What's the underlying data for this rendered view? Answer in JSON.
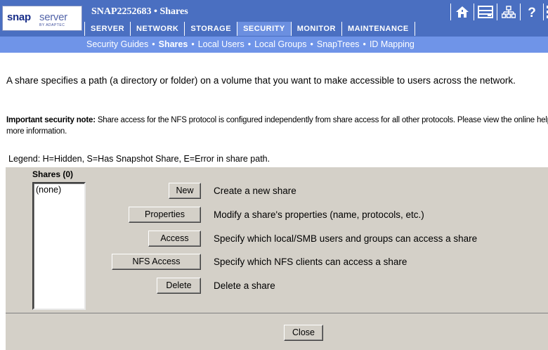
{
  "logo": {
    "brand_bold": "snap",
    "brand_light": "server",
    "sub": "BY ADAPTEC"
  },
  "header": {
    "title": "SNAP2252683 • Shares"
  },
  "tabs": [
    {
      "label": "SERVER"
    },
    {
      "label": "NETWORK"
    },
    {
      "label": "STORAGE"
    },
    {
      "label": "SECURITY",
      "active": true
    },
    {
      "label": "MONITOR"
    },
    {
      "label": "MAINTENANCE"
    }
  ],
  "top_icons": [
    "home-icon",
    "server-list-icon",
    "sitemap-icon",
    "help-icon",
    "data-icon"
  ],
  "subnav": [
    {
      "label": "Security Guides"
    },
    {
      "label": "Shares",
      "active": true
    },
    {
      "label": "Local Users"
    },
    {
      "label": "Local Groups"
    },
    {
      "label": "SnapTrees"
    },
    {
      "label": "ID Mapping"
    }
  ],
  "intro": "A share specifies a path (a directory or folder) on a volume that you want to make accessible to users across the network.",
  "note": {
    "bold": "Important security note:",
    "text": " Share access for the NFS protocol is configured independently from share access for all other protocols. Please view the online help for more information."
  },
  "legend": "Legend: H=Hidden, S=Has Snapshot Share, E=Error in share path.",
  "shares": {
    "label": "Shares (0)",
    "items": [
      "(none)"
    ]
  },
  "actions": [
    {
      "button": "New",
      "description": "Create a new share"
    },
    {
      "button": "Properties",
      "description": "Modify a share's properties (name, protocols, etc.)"
    },
    {
      "button": "Access",
      "description": "Specify which local/SMB users and groups can access a share"
    },
    {
      "button": "NFS Access",
      "description": "Specify which NFS clients can access a share"
    },
    {
      "button": "Delete",
      "description": "Delete a share"
    }
  ],
  "close_button": "Close",
  "colors": {
    "header": "#4a6fc1",
    "subnav": "#6f94e8",
    "panel": "#d4d0c8"
  }
}
